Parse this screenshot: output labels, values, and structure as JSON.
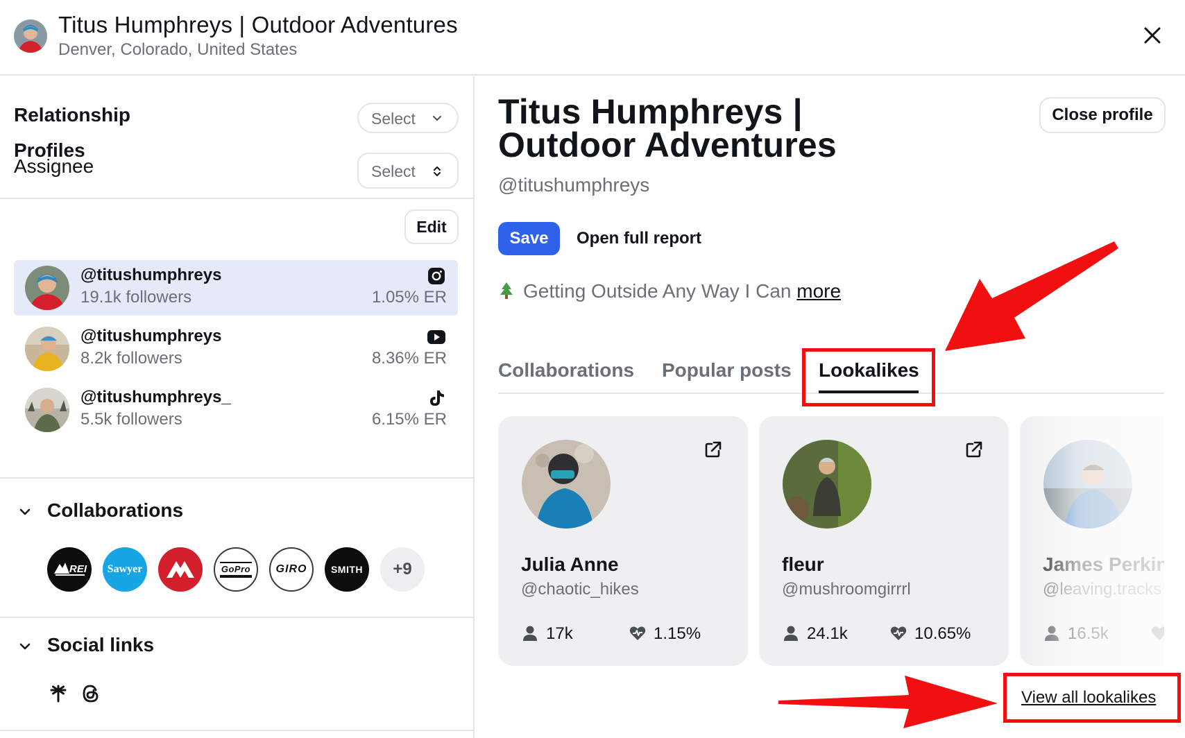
{
  "header": {
    "title": "Titus Humphreys | Outdoor Adventures",
    "location": "Denver, Colorado, United States",
    "close_icon": "close-icon"
  },
  "sidebar": {
    "relationship": {
      "label": "Relationship",
      "value": "Select"
    },
    "assignee": {
      "label": "Assignee",
      "value": "Select"
    },
    "profiles_title": "Profiles",
    "edit_label": "Edit",
    "profiles": [
      {
        "handle": "@titushumphreys",
        "followers": "19.1k followers",
        "er": "1.05% ER",
        "platform": "instagram-icon",
        "selected": true
      },
      {
        "handle": "@titushumphreys",
        "followers": "8.2k followers",
        "er": "8.36% ER",
        "platform": "youtube-icon",
        "selected": false
      },
      {
        "handle": "@titushumphreys_",
        "followers": "5.5k followers",
        "er": "6.15% ER",
        "platform": "tiktok-icon",
        "selected": false
      }
    ],
    "collaborations": {
      "label": "Collaborations",
      "brands": [
        {
          "name": "REI co-op",
          "text": "REI"
        },
        {
          "name": "Sawyer",
          "text": "Sawyer"
        },
        {
          "name": "Mountain Hardwear",
          "text": ""
        },
        {
          "name": "GoPro",
          "text": "GoPro"
        },
        {
          "name": "Giro",
          "text": "GIRO"
        },
        {
          "name": "Smith",
          "text": "SMITH"
        }
      ],
      "more": "+9"
    },
    "social_links": {
      "label": "Social links",
      "icons": [
        "linktree-icon",
        "threads-icon"
      ]
    }
  },
  "main": {
    "title": "Titus Humphreys | Outdoor Adventures",
    "handle": "@titushumphreys",
    "close_profile": "Close profile",
    "save": "Save",
    "open_full_report": "Open full report",
    "bio": "Getting Outside Any Way I Can",
    "bio_more": "more",
    "tabs": [
      {
        "label": "Collaborations",
        "active": false
      },
      {
        "label": "Popular posts",
        "active": false
      },
      {
        "label": "Lookalikes",
        "active": true
      }
    ],
    "lookalikes": [
      {
        "name": "Julia Anne",
        "handle": "@chaotic_hikes",
        "followers": "17k",
        "er": "1.15%"
      },
      {
        "name": "fleur",
        "handle": "@mushroomgirrrl",
        "followers": "24.1k",
        "er": "10.65%"
      },
      {
        "name": "James Perkins",
        "handle": "@leaving.tracks",
        "followers": "16.5k",
        "er": ""
      }
    ],
    "view_all": "View all lookalikes"
  },
  "colors": {
    "accent": "#2e62ea",
    "selected_row": "#e6e9f8",
    "annotation": "#f20f0f"
  }
}
